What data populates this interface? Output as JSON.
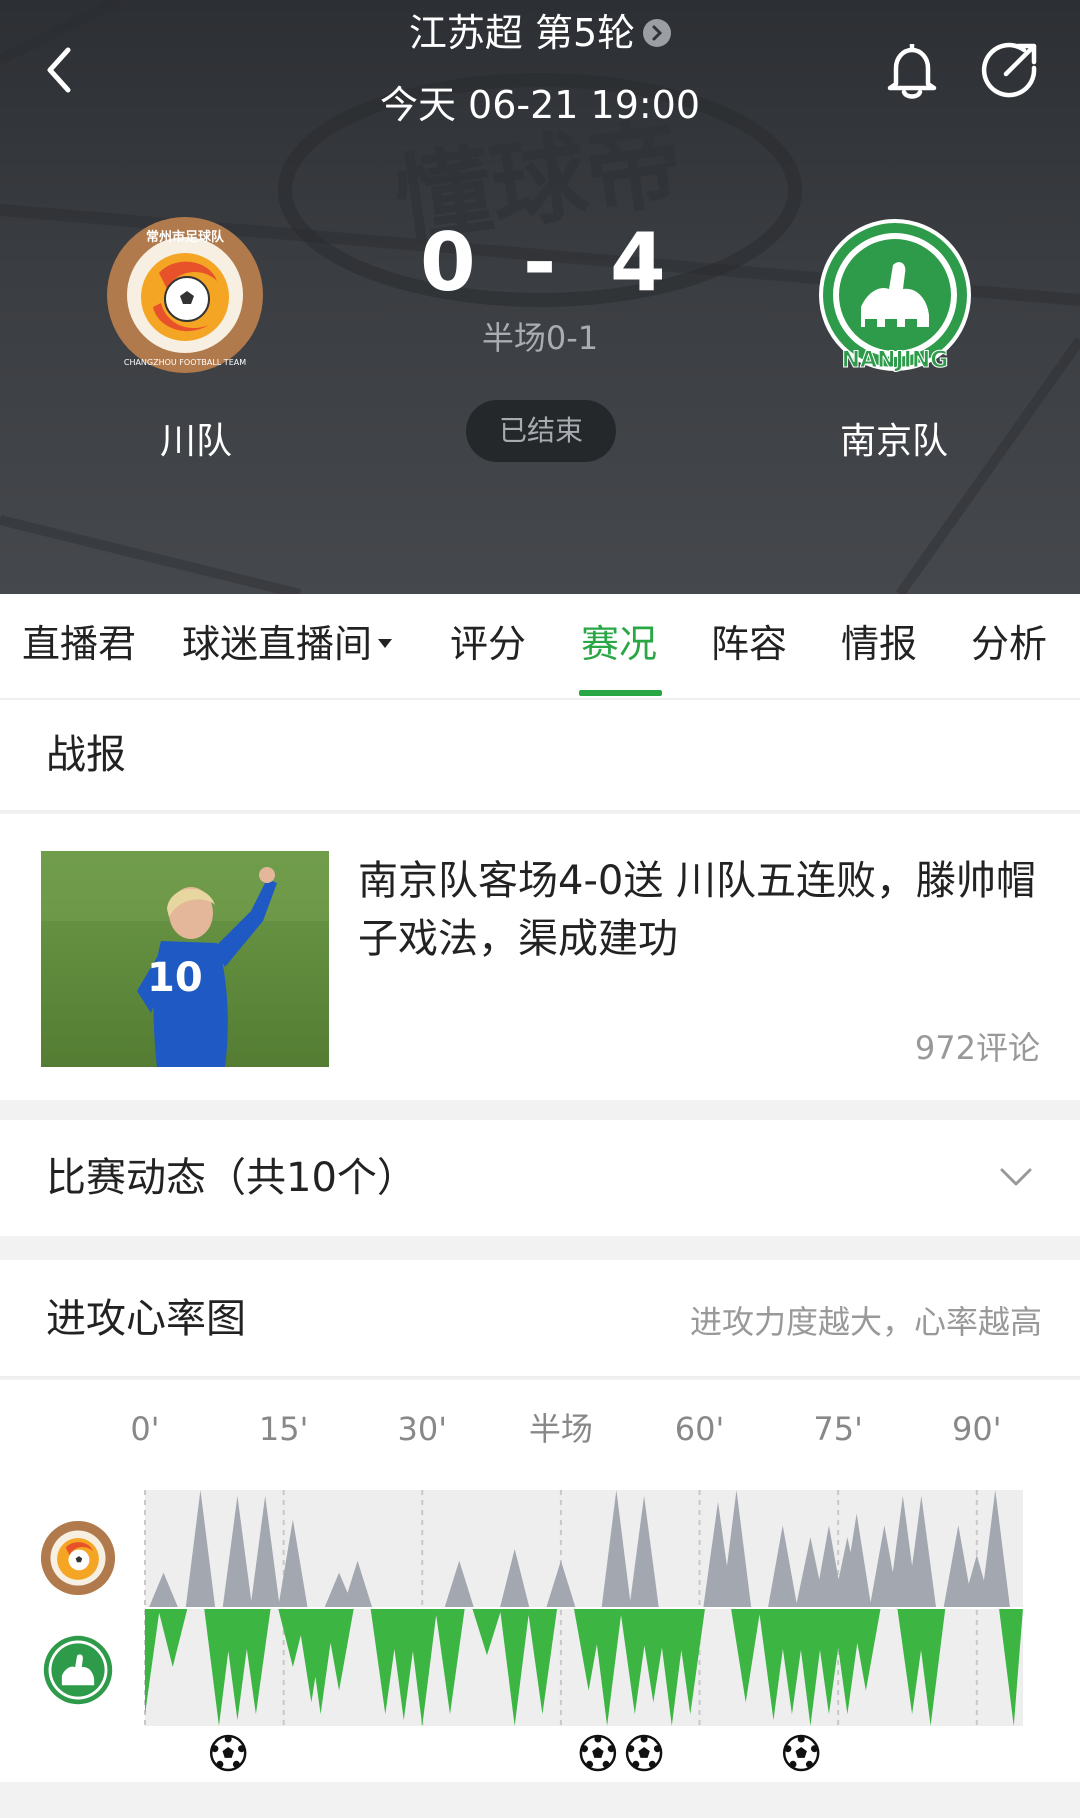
{
  "header": {
    "league": "江苏超 第5轮",
    "datetime": "今天 06-21 19:00",
    "home_team": "川队",
    "away_team": "南京队",
    "home_score": "0",
    "separator": "-",
    "away_score": "4",
    "halftime": "半场0-1",
    "status": "已结束",
    "watermark": "懂球帝",
    "home_logo_text": "常州市足球队",
    "home_logo_sub": "CHANGZHOU FOOTBALL TEAM",
    "away_logo_text": "NANJING"
  },
  "tabs": [
    {
      "label": "直播君"
    },
    {
      "label": "球迷直播间"
    },
    {
      "label": "评分"
    },
    {
      "label": "赛况"
    },
    {
      "label": "阵容"
    },
    {
      "label": "情报"
    },
    {
      "label": "分析"
    }
  ],
  "active_tab": "赛况",
  "report": {
    "section_title": "战报",
    "news_title": "南京队客场4-0送 川队五连败，滕帅帽子戏法，渠成建功",
    "comments": "972评论",
    "player_number": "10"
  },
  "events": {
    "title": "比赛动态（共10个）"
  },
  "heart_rate": {
    "title": "进攻心率图",
    "hint": "进攻力度越大，心率越高",
    "time_labels": [
      "0'",
      "15'",
      "30'",
      "半场",
      "60'",
      "75'",
      "90'"
    ],
    "goal_minutes": [
      9,
      49,
      54,
      71
    ],
    "home_color": "#a3a8b0",
    "away_color": "#3cb543",
    "home_peaks": [
      [
        2,
        0.3
      ],
      [
        6,
        1
      ],
      [
        10,
        0.95
      ],
      [
        13,
        0.95
      ],
      [
        16,
        0.75
      ],
      [
        21,
        0.3
      ],
      [
        23,
        0.4
      ],
      [
        34,
        0.4
      ],
      [
        40,
        0.5
      ],
      [
        45,
        0.4
      ],
      [
        51,
        1
      ],
      [
        54,
        0.95
      ],
      [
        62,
        0.9
      ],
      [
        64,
        1
      ],
      [
        69,
        0.7
      ],
      [
        72,
        0.6
      ],
      [
        74,
        0.7
      ],
      [
        76,
        0.6
      ],
      [
        77,
        0.8
      ],
      [
        80,
        0.7
      ],
      [
        82,
        0.95
      ],
      [
        84,
        0.95
      ],
      [
        88,
        0.7
      ],
      [
        90,
        0.45
      ],
      [
        92,
        1
      ]
    ],
    "away_peaks": [
      [
        0,
        0.9
      ],
      [
        3,
        0.5
      ],
      [
        8,
        1
      ],
      [
        10,
        0.95
      ],
      [
        12,
        0.9
      ],
      [
        16,
        0.5
      ],
      [
        18,
        0.8
      ],
      [
        19,
        0.9
      ],
      [
        21,
        0.7
      ],
      [
        26,
        0.9
      ],
      [
        28,
        0.95
      ],
      [
        30,
        1
      ],
      [
        33,
        0.9
      ],
      [
        37,
        0.4
      ],
      [
        40,
        1
      ],
      [
        43,
        0.9
      ],
      [
        48,
        0.7
      ],
      [
        50,
        1
      ],
      [
        53,
        0.9
      ],
      [
        55,
        0.8
      ],
      [
        57,
        1
      ],
      [
        59,
        0.9
      ],
      [
        65,
        0.8
      ],
      [
        68,
        0.95
      ],
      [
        70,
        0.9
      ],
      [
        72,
        1
      ],
      [
        74,
        0.9
      ],
      [
        76,
        0.9
      ],
      [
        78,
        0.7
      ],
      [
        83,
        0.9
      ],
      [
        85,
        1
      ],
      [
        94,
        1
      ]
    ]
  }
}
